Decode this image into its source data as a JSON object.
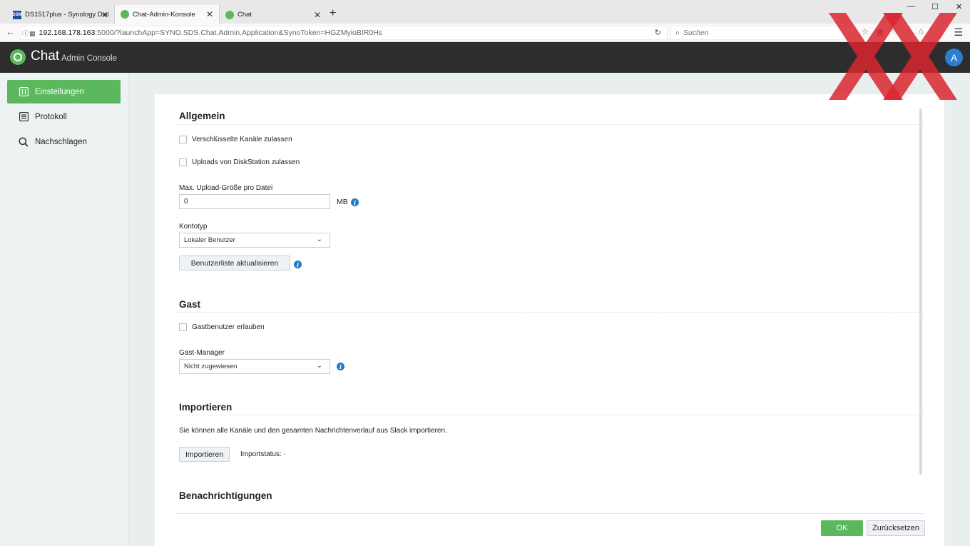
{
  "browser": {
    "tabs": [
      {
        "label": "DS1517plus - Synology Disk",
        "favicon": "DSM"
      },
      {
        "label": "Chat-Admin-Konsole"
      },
      {
        "label": "Chat"
      }
    ],
    "url_host": "192.168.178.163",
    "url_rest": ":5000/?launchApp=SYNO.SDS.Chat.Admin.Application&SynoToken=HGZMyioBIR0Hs",
    "search_placeholder": "Suchen"
  },
  "header": {
    "brand": "Chat",
    "subtitle": "Admin Console",
    "avatar_initial": "A"
  },
  "sidebar": {
    "items": [
      {
        "label": "Einstellungen",
        "icon": "sliders-icon"
      },
      {
        "label": "Protokoll",
        "icon": "list-icon"
      },
      {
        "label": "Nachschlagen",
        "icon": "search-icon"
      }
    ]
  },
  "general": {
    "title": "Allgemein",
    "encrypted_channels": "Verschlüsselte Kanäle zulassen",
    "diskstation_uploads": "Uploads von DiskStation zulassen",
    "max_upload_label": "Max. Upload-Größe pro Datei",
    "max_upload_value": "0",
    "max_upload_unit": "MB",
    "account_type_label": "Kontotyp",
    "account_type_value": "Lokaler Benutzer",
    "refresh_button": "Benutzerliste aktualisieren"
  },
  "guest": {
    "title": "Gast",
    "allow_guest": "Gastbenutzer erlauben",
    "manager_label": "Gast-Manager",
    "manager_value": "Nicht zugewiesen"
  },
  "import": {
    "title": "Importieren",
    "description": "Sie können alle Kanäle und den gesamten Nachrichtenverlauf aus Slack importieren.",
    "button": "Importieren",
    "status_label": "Importstatus:",
    "status_value": "-"
  },
  "notifications": {
    "title": "Benachrichtigungen"
  },
  "footer": {
    "ok": "OK",
    "reset": "Zurücksetzen"
  },
  "colors": {
    "accent_green": "#5bb85d",
    "header_dark": "#2d2d2d",
    "info_blue": "#1f7ac8",
    "watermark_red": "#d9262f"
  }
}
